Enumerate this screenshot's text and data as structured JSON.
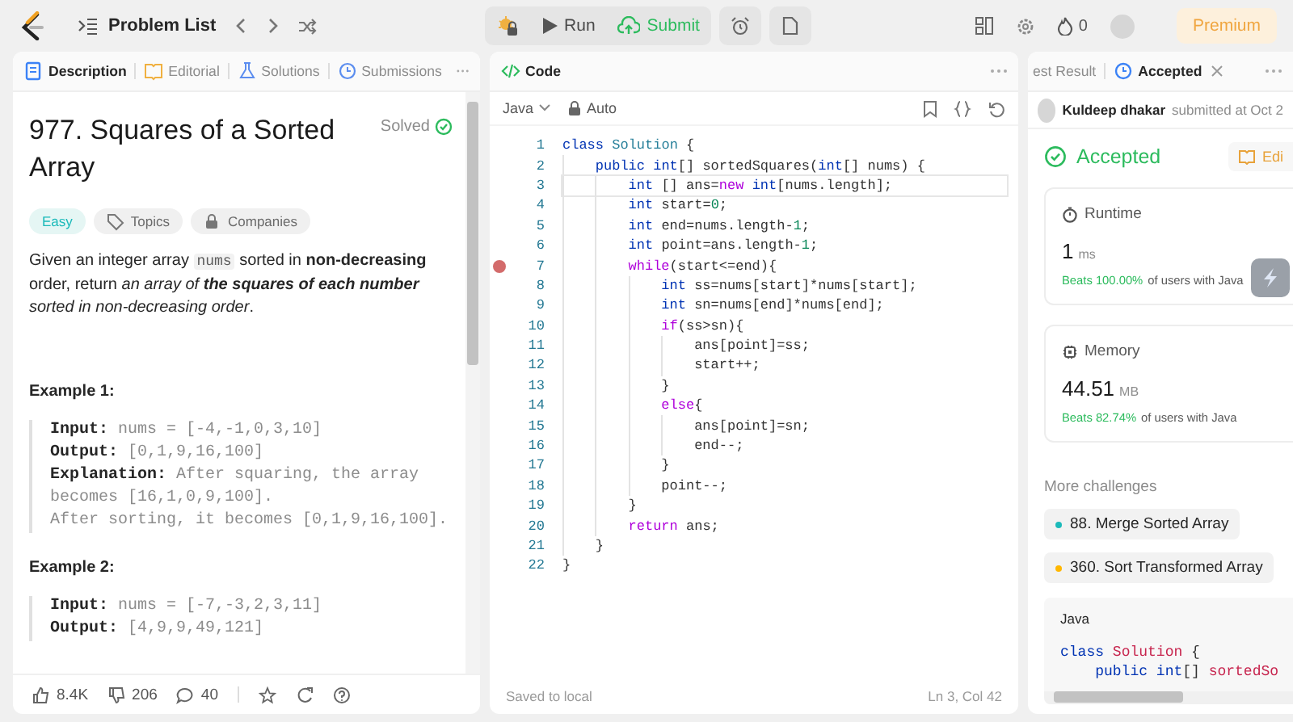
{
  "top_bar": {
    "nav_label": "Problem List",
    "run_label": "Run",
    "submit_label": "Submit",
    "streak": "0",
    "premium_label": "Premium"
  },
  "left_panel": {
    "tabs": [
      {
        "label": "Description",
        "selected": true,
        "kind": "description"
      },
      {
        "label": "Editorial",
        "selected": false,
        "kind": "editorial"
      },
      {
        "label": "Solutions",
        "selected": false,
        "kind": "solutions"
      },
      {
        "label": "Submissions",
        "selected": false,
        "kind": "submissions"
      }
    ],
    "title": "977. Squares of a Sorted Array",
    "status": "Solved",
    "difficulty": "Easy",
    "tags": [
      {
        "label": "Topics",
        "kind": "topics"
      },
      {
        "label": "Companies",
        "kind": "companies"
      }
    ],
    "description": [
      {
        "text": "Given an integer array ",
        "kind": "plain"
      },
      {
        "text": "nums",
        "kind": "code"
      },
      {
        "text": " sorted in ",
        "kind": "plain"
      },
      {
        "text": "non-decreasing",
        "kind": "bold"
      },
      {
        "text": " order, return ",
        "kind": "plain"
      },
      {
        "text": "an array of ",
        "kind": "italic"
      },
      {
        "text": "the squares of each number",
        "kind": "bolditalic"
      },
      {
        "text": " sorted in non-decreasing order",
        "kind": "italic"
      },
      {
        "text": ".",
        "kind": "plain"
      }
    ],
    "examples": [
      {
        "heading": "Example 1:",
        "lines": [
          {
            "label": "Input:",
            "value": "nums = [-4,-1,0,3,10]"
          },
          {
            "label": "Output:",
            "value": "[0,1,9,16,100]"
          },
          {
            "label": "Explanation:",
            "value": "After squaring, the array becomes [16,1,0,9,100]."
          },
          {
            "value": "After sorting, it becomes [0,1,9,16,100]."
          }
        ]
      },
      {
        "heading": "Example 2:",
        "lines": [
          {
            "label": "Input:",
            "value": "nums = [-7,-3,2,3,11]"
          },
          {
            "label": "Output:",
            "value": "[4,9,9,49,121]"
          }
        ]
      }
    ],
    "footer": {
      "likes": "8.4K",
      "dislikes": "206",
      "comments": "40"
    }
  },
  "code_panel": {
    "title": "Code",
    "language": "Java",
    "mode": "Auto",
    "lines": [
      {
        "number": "1",
        "breakpoint": false,
        "current": false,
        "tokens": [
          {
            "text": "class",
            "kind": "kw"
          },
          {
            "text": " Solution",
            "kind": "type"
          },
          {
            "text": " {",
            "kind": "plain"
          }
        ]
      },
      {
        "number": "2",
        "breakpoint": false,
        "current": false,
        "tokens": [
          {
            "text": "    public",
            "kind": "kw"
          },
          {
            "text": " int",
            "kind": "kw"
          },
          {
            "text": "[] sortedSquares(",
            "kind": "plain"
          },
          {
            "text": "int",
            "kind": "kw"
          },
          {
            "text": "[] nums) {",
            "kind": "plain"
          }
        ]
      },
      {
        "number": "3",
        "breakpoint": false,
        "current": true,
        "tokens": [
          {
            "text": "        int",
            "kind": "kw"
          },
          {
            "text": " [] ans=",
            "kind": "plain"
          },
          {
            "text": "new",
            "kind": "ctrl"
          },
          {
            "text": " int",
            "kind": "kw"
          },
          {
            "text": "[nums.length];",
            "kind": "plain"
          }
        ]
      },
      {
        "number": "4",
        "breakpoint": false,
        "current": false,
        "tokens": [
          {
            "text": "        int",
            "kind": "kw"
          },
          {
            "text": " start=",
            "kind": "plain"
          },
          {
            "text": "0",
            "kind": "num"
          },
          {
            "text": ";",
            "kind": "plain"
          }
        ]
      },
      {
        "number": "5",
        "breakpoint": false,
        "current": false,
        "tokens": [
          {
            "text": "        int",
            "kind": "kw"
          },
          {
            "text": " end=nums.length-",
            "kind": "plain"
          },
          {
            "text": "1",
            "kind": "num"
          },
          {
            "text": ";",
            "kind": "plain"
          }
        ]
      },
      {
        "number": "6",
        "breakpoint": false,
        "current": false,
        "tokens": [
          {
            "text": "        int",
            "kind": "kw"
          },
          {
            "text": " point=ans.length-",
            "kind": "plain"
          },
          {
            "text": "1",
            "kind": "num"
          },
          {
            "text": ";",
            "kind": "plain"
          }
        ]
      },
      {
        "number": "7",
        "breakpoint": true,
        "current": false,
        "tokens": [
          {
            "text": "        while",
            "kind": "ctrl"
          },
          {
            "text": "(start<=end){",
            "kind": "plain"
          }
        ]
      },
      {
        "number": "8",
        "breakpoint": false,
        "current": false,
        "tokens": [
          {
            "text": "            int",
            "kind": "kw"
          },
          {
            "text": " ss=nums[start]*nums[start];",
            "kind": "plain"
          }
        ]
      },
      {
        "number": "9",
        "breakpoint": false,
        "current": false,
        "tokens": [
          {
            "text": "            int",
            "kind": "kw"
          },
          {
            "text": " sn=nums[end]*nums[end];",
            "kind": "plain"
          }
        ]
      },
      {
        "number": "10",
        "breakpoint": false,
        "current": false,
        "tokens": [
          {
            "text": "            if",
            "kind": "ctrl"
          },
          {
            "text": "(ss>sn){",
            "kind": "plain"
          }
        ]
      },
      {
        "number": "11",
        "breakpoint": false,
        "current": false,
        "tokens": [
          {
            "text": "                ans[point]=ss;",
            "kind": "plain"
          }
        ]
      },
      {
        "number": "12",
        "breakpoint": false,
        "current": false,
        "tokens": [
          {
            "text": "                start++;",
            "kind": "plain"
          }
        ]
      },
      {
        "number": "13",
        "breakpoint": false,
        "current": false,
        "tokens": [
          {
            "text": "            }",
            "kind": "plain"
          }
        ]
      },
      {
        "number": "14",
        "breakpoint": false,
        "current": false,
        "tokens": [
          {
            "text": "            else",
            "kind": "ctrl"
          },
          {
            "text": "{",
            "kind": "plain"
          }
        ]
      },
      {
        "number": "15",
        "breakpoint": false,
        "current": false,
        "tokens": [
          {
            "text": "                ans[point]=sn;",
            "kind": "plain"
          }
        ]
      },
      {
        "number": "16",
        "breakpoint": false,
        "current": false,
        "tokens": [
          {
            "text": "                end--;",
            "kind": "plain"
          }
        ]
      },
      {
        "number": "17",
        "breakpoint": false,
        "current": false,
        "tokens": [
          {
            "text": "            }",
            "kind": "plain"
          }
        ]
      },
      {
        "number": "18",
        "breakpoint": false,
        "current": false,
        "tokens": [
          {
            "text": "            point--;",
            "kind": "plain"
          }
        ]
      },
      {
        "number": "19",
        "breakpoint": false,
        "current": false,
        "tokens": [
          {
            "text": "        }",
            "kind": "plain"
          }
        ]
      },
      {
        "number": "20",
        "breakpoint": false,
        "current": false,
        "tokens": [
          {
            "text": "        return",
            "kind": "ctrl"
          },
          {
            "text": " ans;",
            "kind": "plain"
          }
        ]
      },
      {
        "number": "21",
        "breakpoint": false,
        "current": false,
        "tokens": [
          {
            "text": "    }",
            "kind": "plain"
          }
        ]
      },
      {
        "number": "22",
        "breakpoint": false,
        "current": false,
        "tokens": [
          {
            "text": "}",
            "kind": "plain"
          }
        ]
      }
    ],
    "status": "Saved to local",
    "cursor": "Ln 3, Col 42"
  },
  "result_panel": {
    "tabs": [
      {
        "label": "est Result",
        "selected": false,
        "closable": false
      },
      {
        "label": "Accepted",
        "selected": true,
        "closable": true
      }
    ],
    "user": "Kuldeep dhakar",
    "submitted": "submitted at Oct 2",
    "verdict": "Accepted",
    "editorial_label": "Edi",
    "stats": [
      {
        "kind": "runtime",
        "label": "Runtime",
        "value": "1",
        "unit": "ms",
        "beats": "Beats 100.00%",
        "suffix": "of users with Java"
      },
      {
        "kind": "memory",
        "label": "Memory",
        "value": "44.51",
        "unit": "MB",
        "beats": "Beats 82.74%",
        "suffix": "of users with Java"
      }
    ],
    "more_heading": "More challenges",
    "challenges": [
      {
        "label": "88. Merge Sorted Array",
        "color": "#1cbaba"
      },
      {
        "label": "360. Sort Transformed Array",
        "color": "#ffb700"
      }
    ],
    "snippet": {
      "language": "Java",
      "lines": [
        {
          "tokens": [
            {
              "text": "class",
              "kind": "kw"
            },
            {
              "text": " Solution",
              "kind": "type"
            },
            {
              "text": " {",
              "kind": "plain"
            }
          ]
        },
        {
          "tokens": [
            {
              "text": "    public",
              "kind": "kw"
            },
            {
              "text": " int",
              "kind": "kw"
            },
            {
              "text": "[] ",
              "kind": "plain"
            },
            {
              "text": "sortedSo",
              "kind": "type"
            }
          ]
        }
      ]
    }
  }
}
